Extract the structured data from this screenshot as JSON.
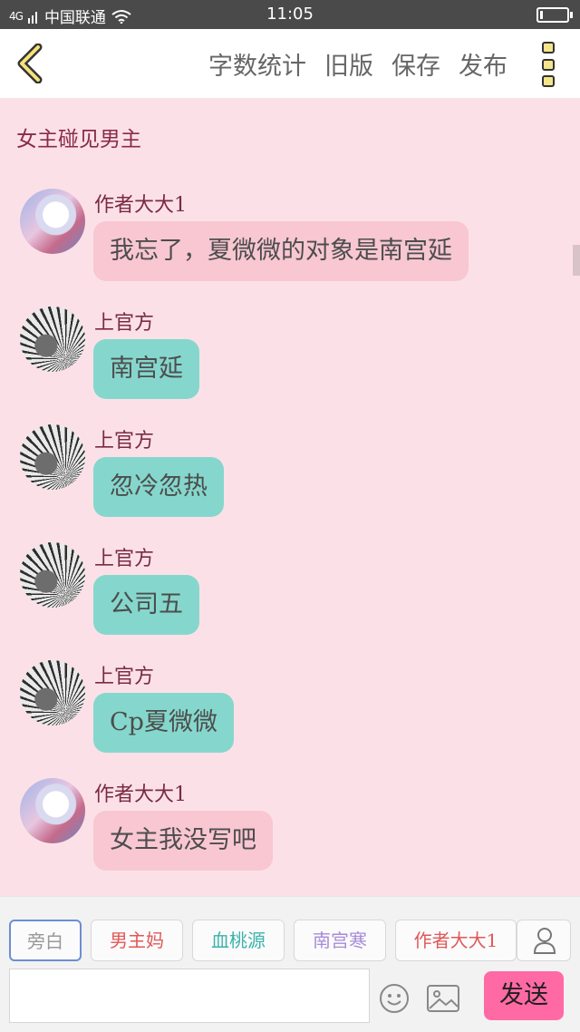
{
  "status_bar": {
    "network": "4G",
    "carrier": "中国联通",
    "time": "11:05",
    "battery_level": 0.12
  },
  "top_bar": {
    "actions": [
      "字数统计",
      "旧版",
      "保存",
      "发布"
    ]
  },
  "chat": {
    "title": "女主碰见男主",
    "messages": [
      {
        "sender": "作者大大1",
        "text": "我忘了，夏微微的对象是南宫延",
        "bubble_color": "#f8c7d2",
        "avatar": "anime-girl-avatar"
      },
      {
        "sender": "上官方",
        "text": "南宫延",
        "bubble_color": "#85d7cd",
        "avatar": "folding-fan-avatar"
      },
      {
        "sender": "上官方",
        "text": "忽冷忽热",
        "bubble_color": "#85d7cd",
        "avatar": "folding-fan-avatar"
      },
      {
        "sender": "上官方",
        "text": "公司五",
        "bubble_color": "#85d7cd",
        "avatar": "folding-fan-avatar"
      },
      {
        "sender": "上官方",
        "text": "Cp夏微微",
        "bubble_color": "#85d7cd",
        "avatar": "folding-fan-avatar"
      },
      {
        "sender": "作者大大1",
        "text": "女主我没写吧",
        "bubble_color": "#f8c7d2",
        "avatar": "anime-girl-avatar"
      }
    ]
  },
  "composer": {
    "roles": [
      {
        "label": "旁白",
        "color": "#999999"
      },
      {
        "label": "男主妈",
        "color": "#e05858"
      },
      {
        "label": "血桃源",
        "color": "#3bb3aa"
      },
      {
        "label": "南宫寒",
        "color": "#a78bd9"
      },
      {
        "label": "作者大大1",
        "color": "#e05858"
      }
    ],
    "send_label": "发送",
    "accent": "#ff6aa4"
  }
}
